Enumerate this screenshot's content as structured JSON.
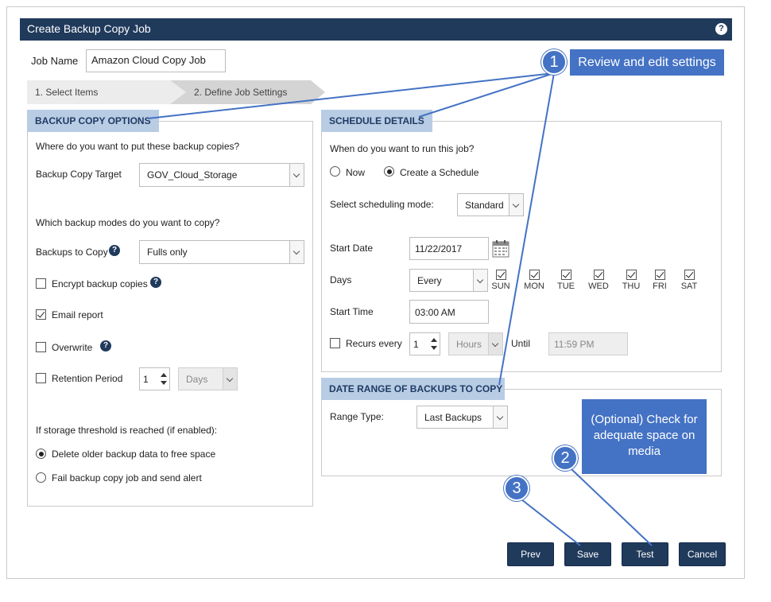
{
  "window": {
    "title": "Create Backup Copy Job",
    "help_glyph": "?"
  },
  "job_name": {
    "label": "Job Name",
    "value": "Amazon Cloud  Copy Job"
  },
  "steps": [
    {
      "label": "1. Select Items",
      "active": false
    },
    {
      "label": "2. Define Job Settings",
      "active": true
    }
  ],
  "backup_copy_options": {
    "legend": "BACKUP COPY OPTIONS",
    "question_target": "Where do you want to put these backup copies?",
    "target_label": "Backup Copy Target",
    "target_value": "GOV_Cloud_Storage",
    "question_modes": "Which backup modes do you want to copy?",
    "backups_to_copy_label": "Backups to Copy",
    "backups_to_copy_value": "Fulls only",
    "encrypt_label": "Encrypt backup copies",
    "encrypt_checked": false,
    "email_label": "Email report",
    "email_checked": true,
    "overwrite_label": "Overwrite",
    "overwrite_checked": false,
    "retention_label": "Retention Period",
    "retention_checked": false,
    "retention_value": "1",
    "retention_unit": "Days",
    "threshold_label": "If storage threshold is reached (if enabled):",
    "threshold_options": [
      {
        "label": "Delete older backup data to free space",
        "selected": true
      },
      {
        "label": "Fail backup copy job and send alert",
        "selected": false
      }
    ]
  },
  "schedule": {
    "legend": "SCHEDULE DETAILS",
    "question": "When do you want to run this job?",
    "run_options": [
      {
        "label": "Now",
        "selected": false
      },
      {
        "label": "Create a Schedule",
        "selected": true
      }
    ],
    "mode_label": "Select scheduling mode:",
    "mode_value": "Standard",
    "start_date_label": "Start Date",
    "start_date_value": "11/22/2017",
    "days_label": "Days",
    "days_value": "Every",
    "days": [
      {
        "label": "SUN",
        "checked": true
      },
      {
        "label": "MON",
        "checked": true
      },
      {
        "label": "TUE",
        "checked": true
      },
      {
        "label": "WED",
        "checked": true
      },
      {
        "label": "THU",
        "checked": true
      },
      {
        "label": "FRI",
        "checked": true
      },
      {
        "label": "SAT",
        "checked": true
      }
    ],
    "start_time_label": "Start Time",
    "start_time_value": "03:00 AM",
    "recurs_label": "Recurs every",
    "recurs_checked": false,
    "recurs_value": "1",
    "recurs_unit": "Hours",
    "until_label": "Until",
    "until_value": "11:59 PM"
  },
  "date_range": {
    "legend": "DATE RANGE OF BACKUPS TO COPY",
    "range_type_label": "Range Type:",
    "range_type_value": "Last Backups"
  },
  "buttons": {
    "prev": "Prev",
    "save": "Save",
    "test": "Test",
    "cancel": "Cancel"
  },
  "annotations": {
    "callout_1": "Review and edit settings",
    "callout_2": "(Optional) Check for adequate space on media",
    "badge_1": "1",
    "badge_2": "2",
    "badge_3": "3"
  },
  "colors": {
    "title_bar": "#203a5c",
    "legend_bg": "#b8cce4",
    "callout": "#4472c4",
    "button": "#203a5c"
  }
}
